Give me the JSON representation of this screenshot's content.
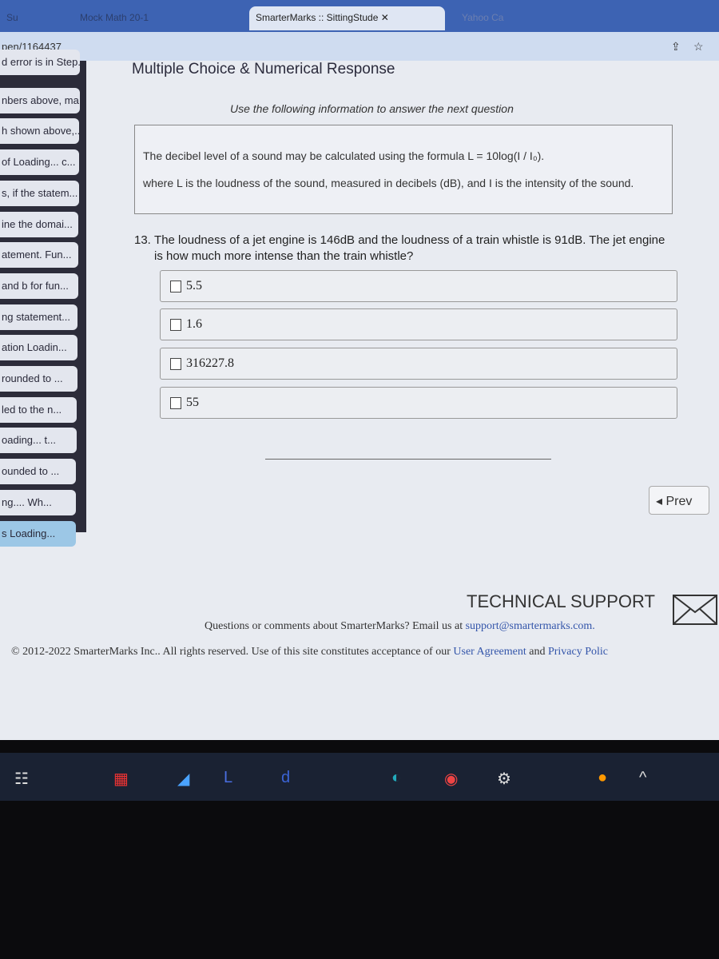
{
  "browser": {
    "tabs": [
      "Su",
      "Mock Math 20-1",
      "SmarterMarks :: SittingStude",
      "Yahoo Ca"
    ],
    "url": "pen/1164437"
  },
  "sidebar": {
    "items": [
      "d error is in Step...",
      "nbers above, ma...",
      "h shown above,...",
      "of Loading... c...",
      "s, if the statem...",
      "ine the domai...",
      "atement. Fun...",
      "and b for fun...",
      "ng statement...",
      "ation Loadin...",
      "rounded to ...",
      "led to the n...",
      "oading... t...",
      "ounded to ...",
      "ng.... Wh...",
      "s Loading..."
    ],
    "current_index": 15
  },
  "main": {
    "heading": "Multiple Choice & Numerical Response",
    "instruction": "Use the following information to answer the next question",
    "info_line1": "The decibel level of a sound may be calculated using the formula L = 10log(I / I₀).",
    "info_line2": "where L is the loudness of the sound, measured in decibels (dB), and I is the intensity of the sound.",
    "question_number": "13.",
    "question": "The loudness of a jet engine is 146dB and the loudness of a train whistle is 91dB. The jet engine is how much more intense than the train whistle?",
    "options": [
      "5.5",
      "1.6",
      "316227.8",
      "55"
    ],
    "prev_label": "◂ Prev"
  },
  "footer": {
    "support_title": "TECHNICAL SUPPORT",
    "support_text": "Questions or comments about SmarterMarks? Email us at ",
    "support_email": "support@smartermarks.com.",
    "copyright": "© 2012-2022 SmarterMarks Inc.. All rights reserved. Use of this site constitutes acceptance of our ",
    "user_agreement": "User Agreement",
    "and": " and ",
    "privacy": "Privacy Polic"
  }
}
